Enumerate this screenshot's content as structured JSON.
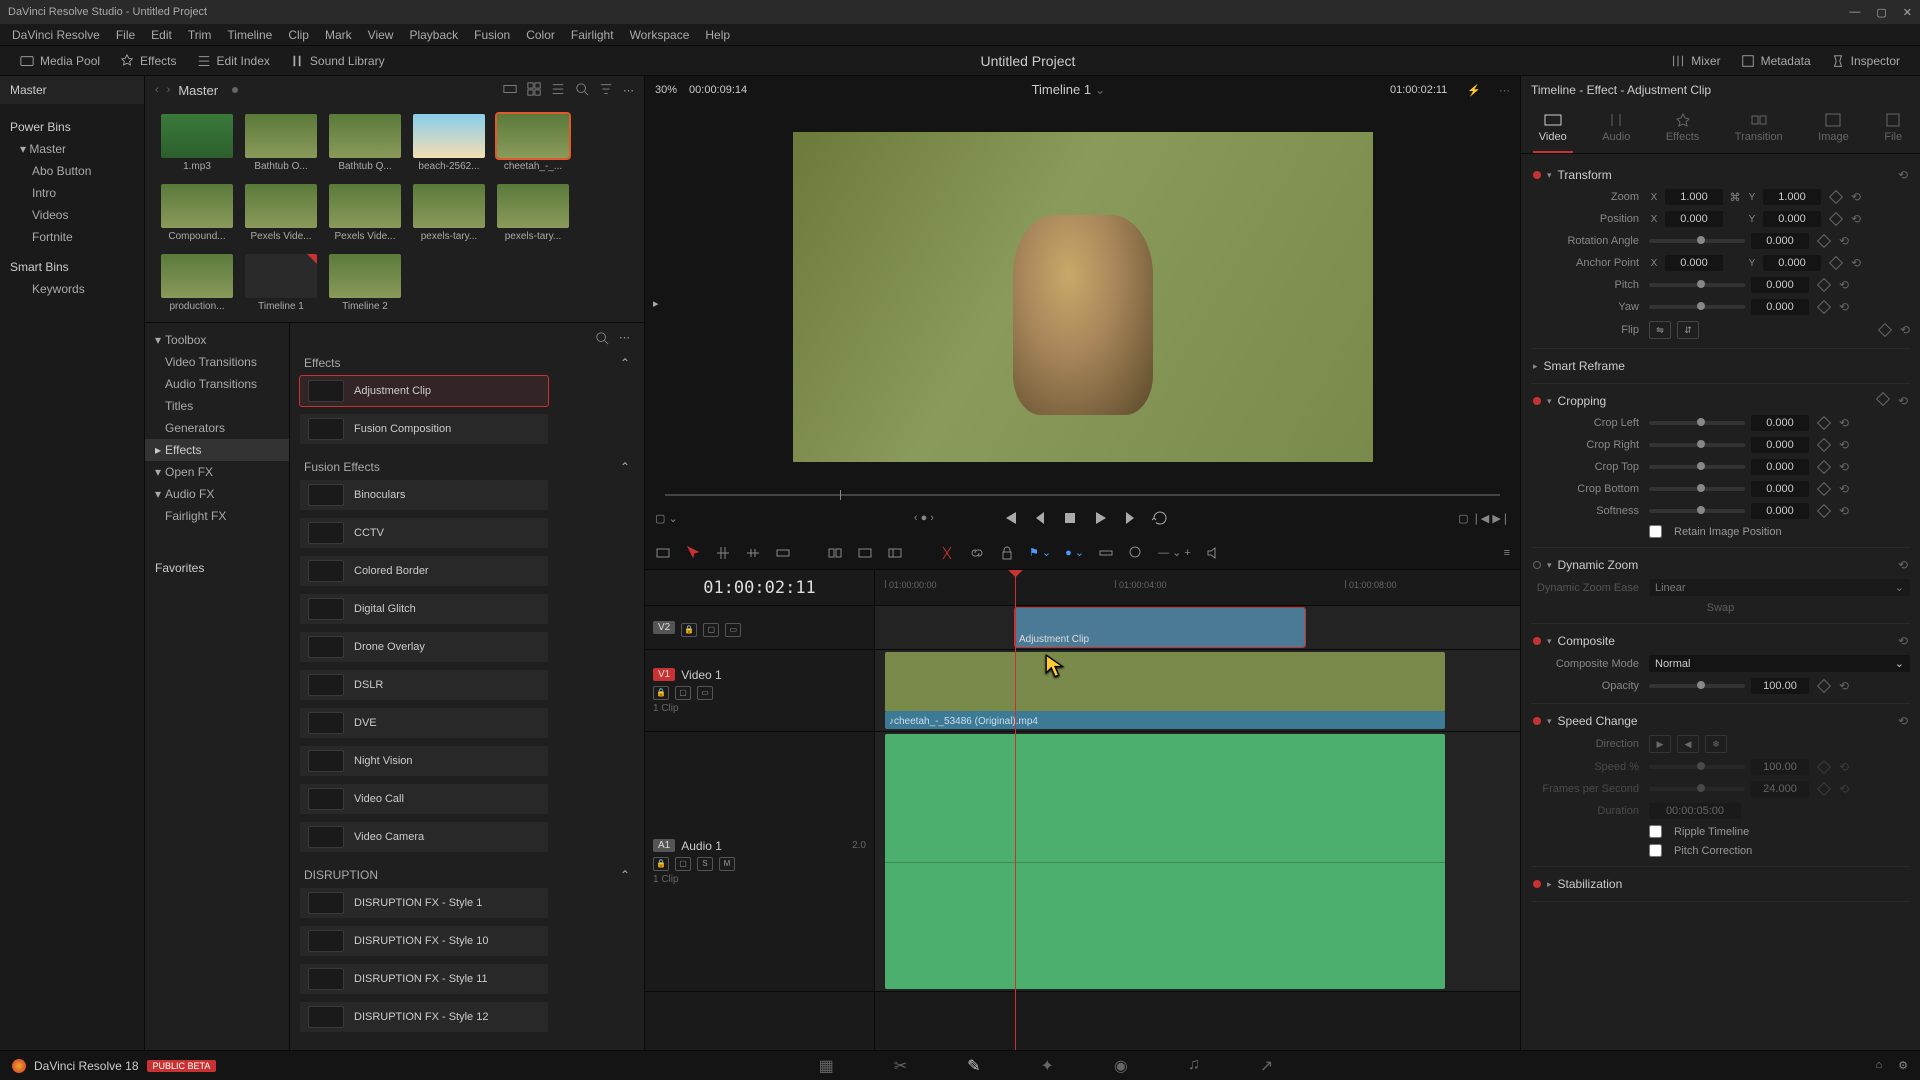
{
  "titleBar": "DaVinci Resolve Studio - Untitled Project",
  "menu": [
    "DaVinci Resolve",
    "File",
    "Edit",
    "Trim",
    "Timeline",
    "Clip",
    "Mark",
    "View",
    "Playback",
    "Fusion",
    "Color",
    "Fairlight",
    "Workspace",
    "Help"
  ],
  "toolbar": {
    "mediaPool": "Media Pool",
    "effects": "Effects",
    "editIndex": "Edit Index",
    "soundLibrary": "Sound Library",
    "mixer": "Mixer",
    "metadata": "Metadata",
    "inspector": "Inspector"
  },
  "projectTitle": "Untitled Project",
  "leftPanel": {
    "header": "Master",
    "powerBins": "Power Bins",
    "masterItem": "Master",
    "masterChildren": [
      "Abo Button",
      "Intro",
      "Videos",
      "Fortnite"
    ],
    "smartBins": "Smart Bins",
    "keywords": "Keywords",
    "favorites": "Favorites"
  },
  "mediaPool": {
    "master": "Master",
    "thumbs": [
      {
        "name": "1.mp3",
        "type": "green"
      },
      {
        "name": "Bathtub O...",
        "type": "nature"
      },
      {
        "name": "Bathtub Q...",
        "type": "nature"
      },
      {
        "name": "beach-2562...",
        "type": "beach"
      },
      {
        "name": "cheetah_-_...",
        "type": "nature",
        "sel": true
      },
      {
        "name": "Compound...",
        "type": "nature"
      },
      {
        "name": "Pexels Vide...",
        "type": "nature"
      },
      {
        "name": "Pexels Vide...",
        "type": "nature"
      },
      {
        "name": "pexels-tary...",
        "type": "nature"
      },
      {
        "name": "pexels-tary...",
        "type": "nature"
      },
      {
        "name": "production...",
        "type": "nature"
      },
      {
        "name": "Timeline 1",
        "type": "timeline"
      },
      {
        "name": "Timeline 2",
        "type": "nature"
      }
    ]
  },
  "fxTree": {
    "toolbox": "Toolbox",
    "items": [
      "Video Transitions",
      "Audio Transitions",
      "Titles",
      "Generators"
    ],
    "effectsItem": "Effects",
    "openFx": "Open FX",
    "audioFx": "Audio FX",
    "fairlightFx": "Fairlight FX"
  },
  "fxList": {
    "effectsTitle": "Effects",
    "effectsItems": [
      "Adjustment Clip",
      "Fusion Composition"
    ],
    "fusionTitle": "Fusion Effects",
    "fusionItems": [
      "Binoculars",
      "CCTV",
      "Colored Border",
      "Digital Glitch",
      "Drone Overlay",
      "DSLR",
      "DVE",
      "Night Vision",
      "Video Call",
      "Video Camera"
    ],
    "disruptionTitle": "DISRUPTION",
    "disruptionItems": [
      "DISRUPTION FX - Style 1",
      "DISRUPTION FX - Style 10",
      "DISRUPTION FX - Style 11",
      "DISRUPTION FX - Style 12"
    ]
  },
  "viewer": {
    "zoom": "30%",
    "tcLeft": "00:00:09:14",
    "timelineName": "Timeline 1",
    "tcRight": "01:00:02:11"
  },
  "timeline": {
    "tc": "01:00:02:11",
    "ticks": [
      "01:00:00:00",
      "01:00:04:00",
      "01:00:08:00"
    ],
    "v2": {
      "badge": "V2"
    },
    "v1": {
      "badge": "V1",
      "name": "Video 1",
      "sub": "1 Clip"
    },
    "a1": {
      "badge": "A1",
      "name": "Audio 1",
      "meter": "2.0",
      "sub": "1 Clip"
    },
    "adjustmentClip": "Adjustment Clip",
    "videoClipName": "cheetah_-_53486 (Original).mp4"
  },
  "inspector": {
    "title": "Timeline - Effect - Adjustment Clip",
    "tabs": [
      "Video",
      "Audio",
      "Effects",
      "Transition",
      "Image",
      "File"
    ],
    "sections": {
      "transform": {
        "title": "Transform",
        "zoom": {
          "label": "Zoom",
          "x": "1.000",
          "y": "1.000"
        },
        "position": {
          "label": "Position",
          "x": "0.000",
          "y": "0.000"
        },
        "rotation": {
          "label": "Rotation Angle",
          "val": "0.000"
        },
        "anchor": {
          "label": "Anchor Point",
          "x": "0.000",
          "y": "0.000"
        },
        "pitch": {
          "label": "Pitch",
          "val": "0.000"
        },
        "yaw": {
          "label": "Yaw",
          "val": "0.000"
        },
        "flip": {
          "label": "Flip"
        }
      },
      "smartReframe": "Smart Reframe",
      "cropping": {
        "title": "Cropping",
        "left": {
          "label": "Crop Left",
          "val": "0.000"
        },
        "right": {
          "label": "Crop Right",
          "val": "0.000"
        },
        "top": {
          "label": "Crop Top",
          "val": "0.000"
        },
        "bottom": {
          "label": "Crop Bottom",
          "val": "0.000"
        },
        "softness": {
          "label": "Softness",
          "val": "0.000"
        },
        "retain": "Retain Image Position"
      },
      "dynamicZoom": {
        "title": "Dynamic Zoom",
        "ease": {
          "label": "Dynamic Zoom Ease",
          "val": "Linear"
        },
        "swap": "Swap"
      },
      "composite": {
        "title": "Composite",
        "mode": {
          "label": "Composite Mode",
          "val": "Normal"
        },
        "opacity": {
          "label": "Opacity",
          "val": "100.00"
        }
      },
      "speedChange": {
        "title": "Speed Change",
        "direction": "Direction",
        "speed": {
          "label": "Speed %",
          "val": "100.00"
        },
        "fps": {
          "label": "Frames per Second",
          "val": "24.000"
        },
        "duration": {
          "label": "Duration",
          "val": "00:00:05:00"
        },
        "ripple": "Ripple Timeline",
        "pitch": "Pitch Correction"
      },
      "stabilization": "Stabilization"
    }
  },
  "bottomNav": {
    "version": "DaVinci Resolve 18",
    "beta": "PUBLIC BETA"
  }
}
